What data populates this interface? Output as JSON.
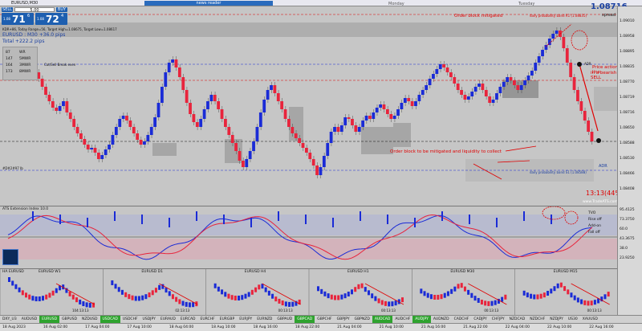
{
  "window": {
    "title": "EURUSD,M30",
    "news_reader": "news reader"
  },
  "trade_panel": {
    "sell_label": "SELL",
    "buy_label": "BUY",
    "lot": "5.00",
    "sell_price_small": "1.08",
    "sell_price_big": "71",
    "sell_price_sup": "6",
    "buy_price_small": "1.08",
    "buy_price_big": "72",
    "buy_price_sup": "4"
  },
  "info": {
    "line1": "KDR+86, Today Range=56, Target High=1.08675, Target Low=1.08617",
    "line2": "EURUSD : M30 +36.0 pips",
    "line3": "Total +222.2 pips",
    "grid": [
      [
        "87",
        "WR"
      ],
      [
        "147",
        "5MWR"
      ],
      [
        "164",
        "3MWR"
      ],
      [
        "173",
        "8MWR"
      ]
    ],
    "cat_label": "Cat/Sell Break even"
  },
  "header": {
    "day1": "Monday",
    "day2": "Tuesday",
    "price": "1.08716",
    "spread": "spread 0.8"
  },
  "annotations": {
    "ob_mitigated": "Order block mitigated",
    "band_r1": "daily probability band R1 (1.08835)",
    "band_s1": "daily probability band S1 (1.08588)",
    "adr": "ADR",
    "adr_s": "ADR",
    "ob_text": "Order block to be mitigated and liquidity to collect",
    "price_action": "Price action return line",
    "bearish": "in a bearish move - SELL",
    "timer": "13:13(44%)",
    "website": "www.TradeATS.com",
    "left_label": "#D#2#97 Ib"
  },
  "price_axis": [
    "1.09010",
    "1.08958",
    "1.08895",
    "1.08835",
    "1.08770",
    "1.08719",
    "1.08716",
    "1.08650",
    "1.08588",
    "1.08530",
    "1.08466",
    "1.08408"
  ],
  "oscillator": {
    "title": "ATS Extension Index 10.0",
    "labels": [
      "TVO",
      "Rise off",
      "Add-on",
      "Fall off"
    ],
    "axis": [
      "95.4125",
      "73.3750",
      "60.0",
      "43.3675",
      "38.0",
      "23.9250"
    ]
  },
  "ha_panel": {
    "title": "HA EURUSD",
    "charts": [
      "EURUSD W1",
      "EURUSD D1",
      "EURUSD H4",
      "EURUSD H1",
      "EURUSD M30",
      "EURUSD M15"
    ],
    "times": [
      "104:13:13",
      "02:13:13",
      "00:13:13",
      "00:13:13",
      "00:13:13",
      "00:13:13"
    ]
  },
  "pair_bar": [
    "DXY_U3",
    "AUDUSD",
    "EURUSD",
    "GBPUSD",
    "NZDUSD",
    "USDCAD",
    "USDCHF",
    "USDJPY",
    "EURAUD",
    "EURCAD",
    "EURCHF",
    "EURGBP",
    "EURJPY",
    "EURNZD",
    "GBPAUD",
    "GBPCAD",
    "GBPCHF",
    "GBPJPY",
    "GBPNZD",
    "AUDCAD",
    "AUDCHF",
    "AUDJPY",
    "AUDNZD",
    "CADCHF",
    "CADJPY",
    "CHFJPY",
    "NZDCAD",
    "NZDCHF",
    "NZDJPY",
    "US30",
    "XAUUSD"
  ],
  "pair_active": [
    2,
    5,
    15,
    19,
    21
  ],
  "time_axis": [
    "18 Aug 2023",
    "16 Aug 02:00",
    "17 Aug 04:00",
    "17 Aug 10:00",
    "18 Aug 04:00",
    "18 Aug 10:00",
    "18 Aug 16:00",
    "18 Aug 22:00",
    "21 Aug 04:00",
    "21 Aug 10:00",
    "21 Aug 16:00",
    "21 Aug 22:00",
    "22 Aug 04:00",
    "22 Aug 10:00",
    "22 Aug 16:00"
  ],
  "colors": {
    "bull": "#1a2bd6",
    "bear": "#e8243c",
    "zone": "#8c8c8c",
    "accent": "#1e5fb0"
  }
}
